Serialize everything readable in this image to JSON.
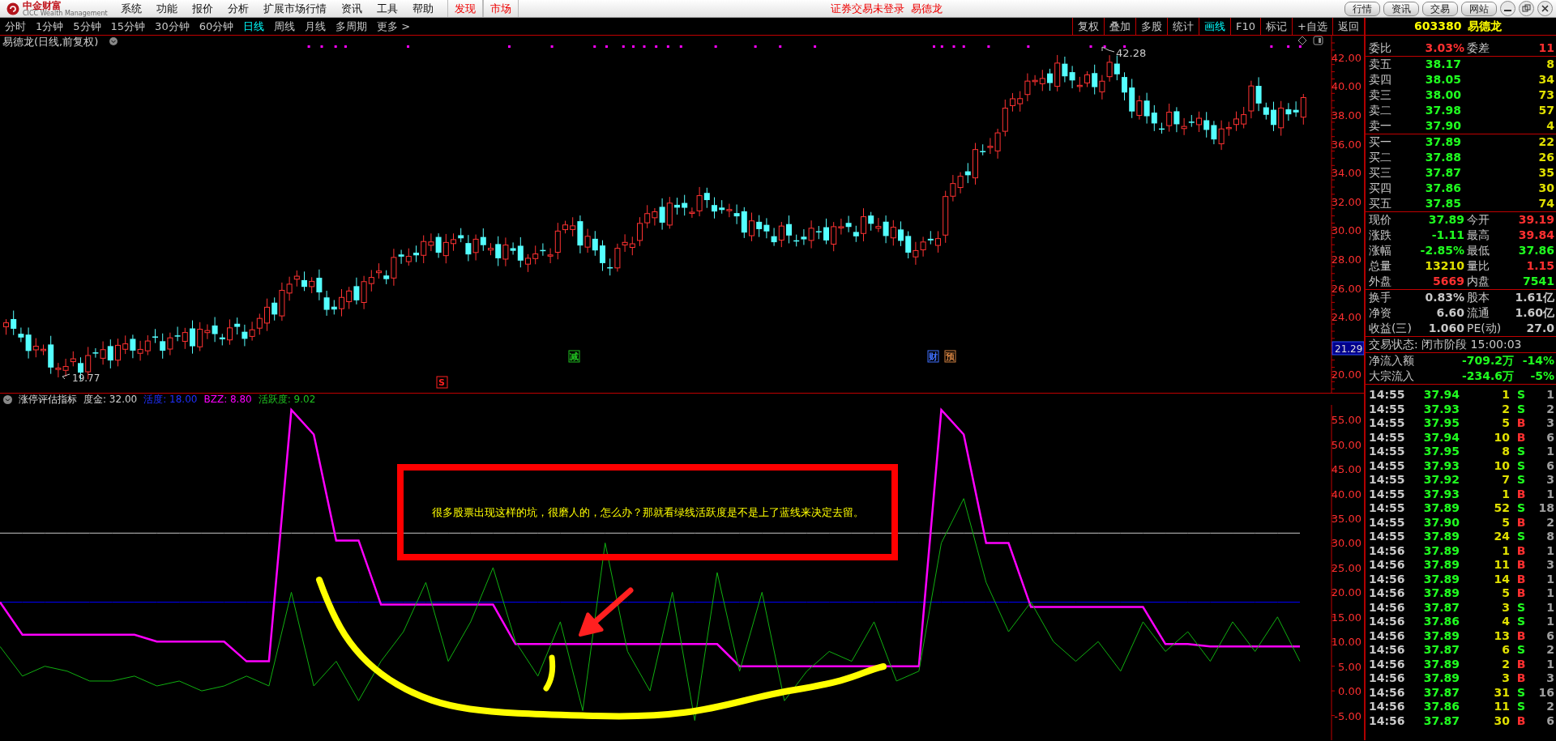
{
  "menubar": {
    "logo": {
      "name": "中金财富",
      "subtitle": "CICC Wealth Management"
    },
    "menus": [
      "系统",
      "功能",
      "报价",
      "分析",
      "扩展市场行情",
      "资讯",
      "工具",
      "帮助"
    ],
    "tabs": [
      "发现",
      "市场"
    ],
    "status": "证券交易未登录  易德龙",
    "buttons": [
      "行情",
      "资讯",
      "交易",
      "网站"
    ]
  },
  "periods": [
    {
      "label": "分时",
      "selected": false
    },
    {
      "label": "1分钟",
      "selected": false
    },
    {
      "label": "5分钟",
      "selected": false
    },
    {
      "label": "15分钟",
      "selected": false
    },
    {
      "label": "30分钟",
      "selected": false
    },
    {
      "label": "60分钟",
      "selected": false
    },
    {
      "label": "日线",
      "selected": true
    },
    {
      "label": "周线",
      "selected": false
    },
    {
      "label": "月线",
      "selected": false
    },
    {
      "label": "多周期",
      "selected": false
    },
    {
      "label": "更多 >",
      "selected": false
    }
  ],
  "tools": [
    {
      "label": "复权",
      "selected": false
    },
    {
      "label": "叠加",
      "selected": false
    },
    {
      "label": "多股",
      "selected": false
    },
    {
      "label": "统计",
      "selected": false
    },
    {
      "label": "画线",
      "selected": true
    },
    {
      "label": "F10",
      "selected": false
    },
    {
      "label": "标记",
      "selected": false
    },
    {
      "label": "+自选",
      "selected": false
    },
    {
      "label": "返回",
      "selected": false
    }
  ],
  "price_chart": {
    "title": "易德龙(日线,前复权)",
    "axis_labels": [
      "42.00",
      "40.00",
      "38.00",
      "36.00",
      "34.00",
      "32.00",
      "30.00",
      "28.00",
      "26.00",
      "24.00",
      "20.00"
    ],
    "current_price": "21.29",
    "high_label": "42.28",
    "low_label": "19.77",
    "events": [
      {
        "text": "S",
        "color": "#ff2020"
      },
      {
        "text": "减",
        "color": "#20c020"
      },
      {
        "text": "财",
        "color": "#4070ff"
      },
      {
        "text": "预",
        "color": "#d08040"
      }
    ]
  },
  "indicator": {
    "name": "涨停评估指标",
    "legend": [
      {
        "value": ": 32.00",
        "color": "#d0d0d0"
      },
      {
        "value": ": 18.00",
        "color": "#2030ff"
      },
      {
        "value": ": 8.80",
        "color": "#ff00ff"
      },
      {
        "value": ": 9.02",
        "color": "#20c020"
      }
    ],
    "note": "很多股票出现这样的坑，很磨人的，怎么办？那就看绿线活跃度是不是上了蓝线来决定去留。",
    "chart_data": {
      "type": "line",
      "ylim": [
        -10,
        58
      ],
      "yticks": [
        {
          "value": 55,
          "label": "55.00"
        },
        {
          "value": 50,
          "label": "50.00"
        },
        {
          "value": 45,
          "label": "45.00"
        },
        {
          "value": 40,
          "label": "40.00"
        },
        {
          "value": 35,
          "label": "35.00"
        },
        {
          "value": 30,
          "label": "30.00"
        },
        {
          "value": 25,
          "label": "25.00"
        },
        {
          "value": 20,
          "label": "20.00"
        },
        {
          "value": 15,
          "label": "15.00"
        },
        {
          "value": 10,
          "label": "10.00"
        },
        {
          "value": 5,
          "label": "5.00"
        },
        {
          "value": 0,
          "label": "0.00"
        },
        {
          "value": -5,
          "label": "-5.00"
        }
      ],
      "series": [
        {
          "name": "度金",
          "color": "#c8c8c8",
          "values": [
            32,
            32,
            32,
            32,
            32,
            32,
            32,
            32,
            32,
            32,
            32,
            32,
            32,
            32,
            32,
            32,
            32,
            32,
            32,
            32,
            32,
            32,
            32,
            32,
            32,
            32,
            32,
            32,
            32,
            32,
            32,
            32,
            32,
            32,
            32,
            32,
            32,
            32,
            32,
            32,
            32,
            32,
            32,
            32,
            32,
            32,
            32,
            32,
            32,
            32,
            32,
            32,
            32,
            32,
            32,
            32,
            32,
            32,
            32
          ]
        },
        {
          "name": "活度",
          "color": "#0000ff",
          "values": [
            18,
            18,
            18,
            18,
            18,
            18,
            18,
            18,
            18,
            18,
            18,
            18,
            18,
            18,
            18,
            18,
            18,
            18,
            18,
            18,
            18,
            18,
            18,
            18,
            18,
            18,
            18,
            18,
            18,
            18,
            18,
            18,
            18,
            18,
            18,
            18,
            18,
            18,
            18,
            18,
            18,
            18,
            18,
            18,
            18,
            18,
            18,
            18,
            18,
            18,
            18,
            18,
            18,
            18,
            18,
            18,
            18,
            18,
            18
          ]
        },
        {
          "name": "BZZ",
          "color": "#ff00ff",
          "values": [
            18,
            11.4,
            11.4,
            11.4,
            11.4,
            11.4,
            11.4,
            10,
            10,
            10,
            10,
            6,
            6,
            57,
            52,
            30.5,
            30.5,
            17.5,
            17.5,
            17.5,
            17.5,
            17.5,
            17.5,
            9.5,
            9.5,
            9.5,
            9.5,
            9.5,
            9.5,
            9.5,
            9.5,
            9.5,
            9.5,
            5,
            5,
            5,
            5,
            5,
            5,
            5,
            5,
            5,
            57,
            52,
            30,
            30,
            17,
            17,
            17,
            17,
            17,
            17,
            9.5,
            9.5,
            9,
            9,
            9,
            9,
            9
          ]
        },
        {
          "name": "活跃度",
          "color": "#10b010",
          "values": [
            9,
            3,
            5,
            4,
            2,
            2,
            3,
            1,
            2,
            0,
            1,
            3,
            1,
            20,
            1,
            6,
            -2,
            6,
            12,
            22,
            6,
            14,
            25,
            10,
            3,
            14,
            -4,
            30,
            8,
            0,
            20,
            -6,
            24,
            4,
            20,
            -2,
            4,
            8,
            6,
            14,
            2,
            4,
            30,
            39,
            22,
            12,
            18,
            10,
            6,
            10,
            4,
            14,
            8,
            12,
            6,
            14,
            8,
            15,
            6
          ]
        }
      ]
    }
  },
  "quote": {
    "code": "603380",
    "name": "易德龙",
    "ratio": [
      {
        "label": "委比",
        "value": "3.03%",
        "color": "#ff3030"
      },
      {
        "label": "委差",
        "value": "11",
        "color": "#ff3030"
      }
    ],
    "asks": [
      {
        "label": "卖五",
        "price": "38.17",
        "volume": "8"
      },
      {
        "label": "卖四",
        "price": "38.05",
        "volume": "34"
      },
      {
        "label": "卖三",
        "price": "38.00",
        "volume": "73"
      },
      {
        "label": "卖二",
        "price": "37.98",
        "volume": "57"
      },
      {
        "label": "卖一",
        "price": "37.90",
        "volume": "4"
      }
    ],
    "bids": [
      {
        "label": "买一",
        "price": "37.89",
        "volume": "22"
      },
      {
        "label": "买二",
        "price": "37.88",
        "volume": "26"
      },
      {
        "label": "买三",
        "price": "37.87",
        "volume": "35"
      },
      {
        "label": "买四",
        "price": "37.86",
        "volume": "30"
      },
      {
        "label": "买五",
        "price": "37.85",
        "volume": "74"
      }
    ],
    "stats": [
      {
        "label": "现价",
        "value": "37.89",
        "color": "#20ff20"
      },
      {
        "label": "今开",
        "value": "39.19",
        "color": "#ff3030"
      },
      {
        "label": "涨跌",
        "value": "-1.11",
        "color": "#20ff20"
      },
      {
        "label": "最高",
        "value": "39.84",
        "color": "#ff3030"
      },
      {
        "label": "涨幅",
        "value": "-2.85%",
        "color": "#20ff20"
      },
      {
        "label": "最低",
        "value": "37.86",
        "color": "#20ff20"
      },
      {
        "label": "总量",
        "value": "13210",
        "color": "#e0e000"
      },
      {
        "label": "量比",
        "value": "1.15",
        "color": "#ff3030"
      },
      {
        "label": "外盘",
        "value": "5669",
        "color": "#ff3030"
      },
      {
        "label": "内盘",
        "value": "7541",
        "color": "#20ff20"
      }
    ],
    "fundamentals": [
      {
        "label": "换手",
        "value": "0.83%"
      },
      {
        "label": "股本",
        "value": "1.61亿"
      },
      {
        "label": "净资",
        "value": "6.60"
      },
      {
        "label": "流通",
        "value": "1.60亿"
      },
      {
        "label": "收益(三)",
        "value": "1.060"
      },
      {
        "label": "PE(动)",
        "value": "27.0"
      }
    ],
    "trading_status": "交易状态: 闭市阶段 15:00:03",
    "flows": [
      {
        "label": "净流入额",
        "amount": "-709.2万",
        "percent": "-14%"
      },
      {
        "label": "大宗流入",
        "amount": "-234.6万",
        "percent": "-5%"
      }
    ],
    "ticks": [
      {
        "time": "14:55",
        "price": "37.94",
        "volume": "1",
        "side": "S",
        "count": "1",
        "color": "#20ff20"
      },
      {
        "time": "14:55",
        "price": "37.93",
        "volume": "2",
        "side": "S",
        "count": "2",
        "color": "#20ff20"
      },
      {
        "time": "14:55",
        "price": "37.95",
        "volume": "5",
        "side": "B",
        "count": "3",
        "color": "#ff3030"
      },
      {
        "time": "14:55",
        "price": "37.94",
        "volume": "10",
        "side": "B",
        "count": "6",
        "color": "#ff3030"
      },
      {
        "time": "14:55",
        "price": "37.95",
        "volume": "8",
        "side": "S",
        "count": "1",
        "color": "#20ff20"
      },
      {
        "time": "14:55",
        "price": "37.93",
        "volume": "10",
        "side": "S",
        "count": "6",
        "color": "#20ff20"
      },
      {
        "time": "14:55",
        "price": "37.92",
        "volume": "7",
        "side": "S",
        "count": "3",
        "color": "#20ff20"
      },
      {
        "time": "14:55",
        "price": "37.93",
        "volume": "1",
        "side": "B",
        "count": "1",
        "color": "#ff3030"
      },
      {
        "time": "14:55",
        "price": "37.89",
        "volume": "52",
        "side": "S",
        "count": "18",
        "color": "#20ff20"
      },
      {
        "time": "14:55",
        "price": "37.90",
        "volume": "5",
        "side": "B",
        "count": "2",
        "color": "#ff3030"
      },
      {
        "time": "14:55",
        "price": "37.89",
        "volume": "24",
        "side": "S",
        "count": "8",
        "color": "#20ff20"
      },
      {
        "time": "14:56",
        "price": "37.89",
        "volume": "1",
        "side": "B",
        "count": "1",
        "color": "#ff3030"
      },
      {
        "time": "14:56",
        "price": "37.89",
        "volume": "11",
        "side": "B",
        "count": "3",
        "color": "#ff3030"
      },
      {
        "time": "14:56",
        "price": "37.89",
        "volume": "14",
        "side": "B",
        "count": "1",
        "color": "#ff3030"
      },
      {
        "time": "14:56",
        "price": "37.89",
        "volume": "5",
        "side": "B",
        "count": "1",
        "color": "#ff3030"
      },
      {
        "time": "14:56",
        "price": "37.87",
        "volume": "3",
        "side": "S",
        "count": "1",
        "color": "#20ff20"
      },
      {
        "time": "14:56",
        "price": "37.86",
        "volume": "4",
        "side": "S",
        "count": "1",
        "color": "#20ff20"
      },
      {
        "time": "14:56",
        "price": "37.89",
        "volume": "13",
        "side": "B",
        "count": "6",
        "color": "#ff3030"
      },
      {
        "time": "14:56",
        "price": "37.87",
        "volume": "6",
        "side": "S",
        "count": "2",
        "color": "#20ff20"
      },
      {
        "time": "14:56",
        "price": "37.89",
        "volume": "2",
        "side": "B",
        "count": "1",
        "color": "#ff3030"
      },
      {
        "time": "14:56",
        "price": "37.89",
        "volume": "3",
        "side": "B",
        "count": "3",
        "color": "#ff3030"
      },
      {
        "time": "14:56",
        "price": "37.87",
        "volume": "31",
        "side": "S",
        "count": "16",
        "color": "#20ff20"
      },
      {
        "time": "14:56",
        "price": "37.86",
        "volume": "11",
        "side": "S",
        "count": "2",
        "color": "#20ff20"
      },
      {
        "time": "14:56",
        "price": "37.87",
        "volume": "30",
        "side": "B",
        "count": "6",
        "color": "#ff3030"
      }
    ]
  }
}
